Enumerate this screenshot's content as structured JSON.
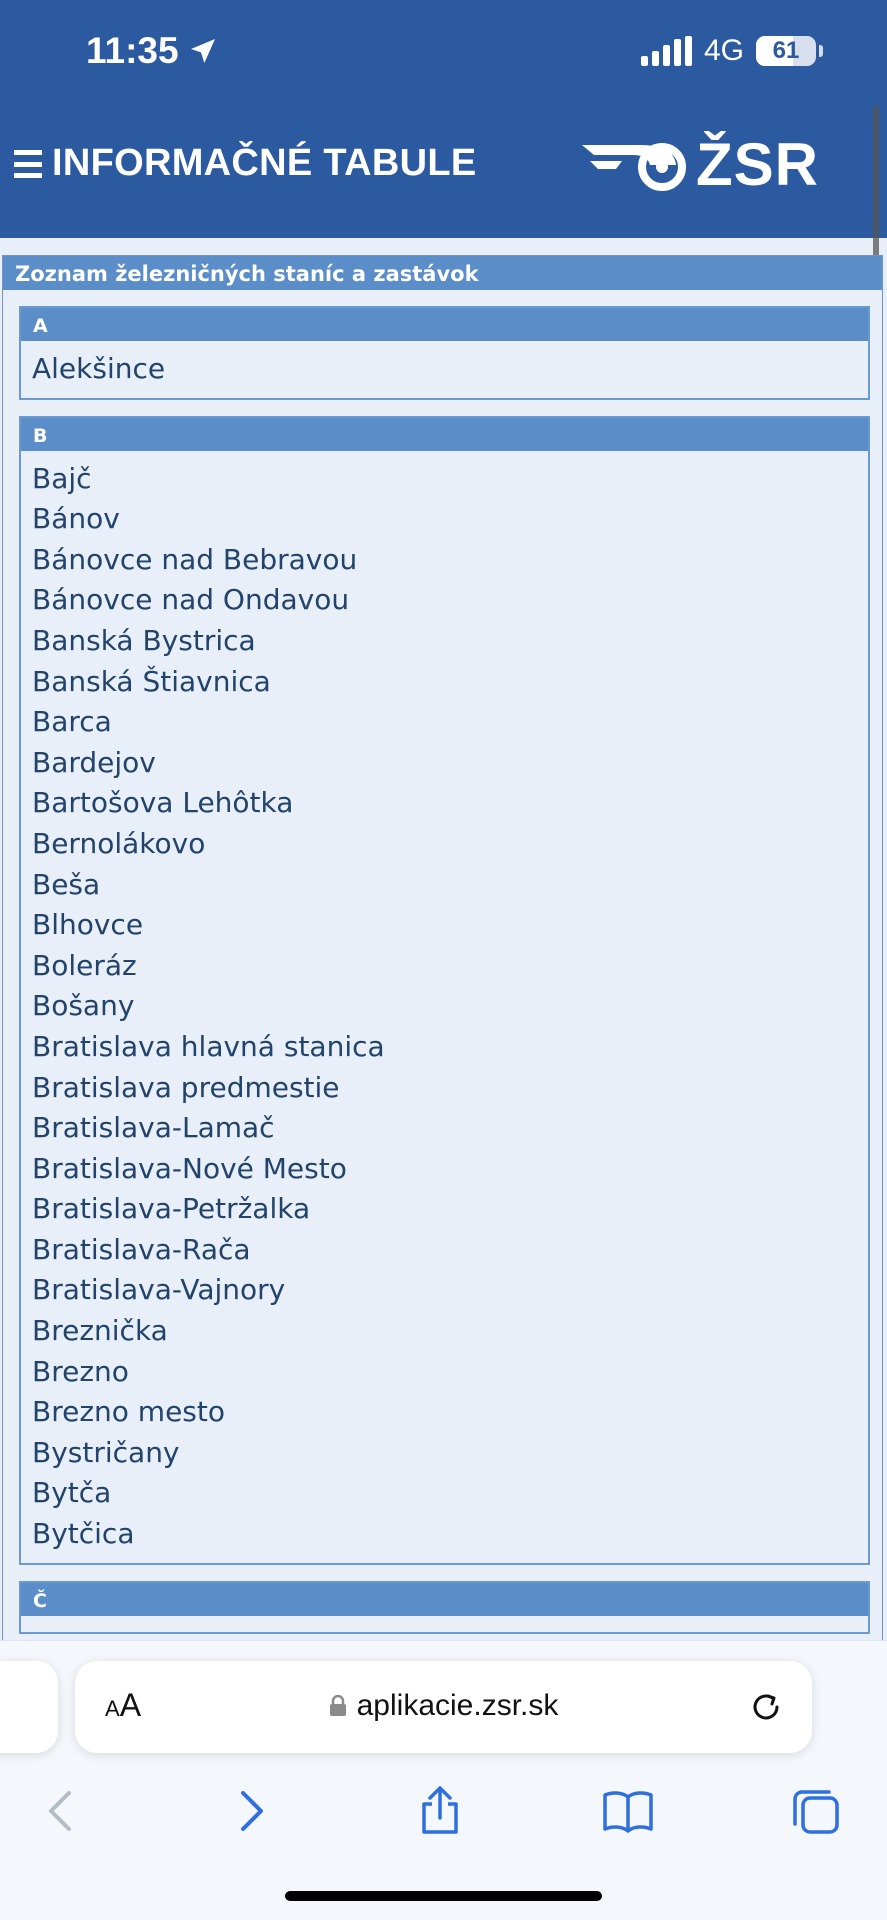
{
  "status_bar": {
    "time": "11:35",
    "network": "4G",
    "battery": "61",
    "battery_level": 0.61
  },
  "header": {
    "title": "INFORMAČNÉ TABULE",
    "logo_text": "ŽSR",
    "menu_icon": "hamburger-icon"
  },
  "page": {
    "panel_title": "Zoznam železničných staníc a zastávok",
    "sections": [
      {
        "letter": "A",
        "stations": [
          "Alekšince"
        ]
      },
      {
        "letter": "B",
        "stations": [
          "Bajč",
          "Bánov",
          "Bánovce nad Bebravou",
          "Bánovce nad Ondavou",
          "Banská Bystrica",
          "Banská Štiavnica",
          "Barca",
          "Bardejov",
          "Bartošova Lehôtka",
          "Bernolákovo",
          "Beša",
          "Blhovce",
          "Boleráz",
          "Bošany",
          "Bratislava hlavná stanica",
          "Bratislava predmestie",
          "Bratislava-Lamač",
          "Bratislava-Nové Mesto",
          "Bratislava-Petržalka",
          "Bratislava-Rača",
          "Bratislava-Vajnory",
          "Breznička",
          "Brezno",
          "Brezno mesto",
          "Bystričany",
          "Bytča",
          "Bytčica"
        ]
      },
      {
        "letter": "Č",
        "stations": []
      }
    ]
  },
  "browser": {
    "text_size_label_small": "A",
    "text_size_label_large": "A",
    "url": "aplikacie.zsr.sk",
    "icons": [
      "lock-icon",
      "reload-icon",
      "back-icon",
      "forward-icon",
      "share-icon",
      "bookmarks-icon",
      "tabs-icon"
    ],
    "accent": "#2f6fde",
    "disabled": "#b4bcc8"
  },
  "colors": {
    "header_bg": "#2b5aa0",
    "section_head": "#5b8dc8",
    "station_text": "#22446c"
  }
}
